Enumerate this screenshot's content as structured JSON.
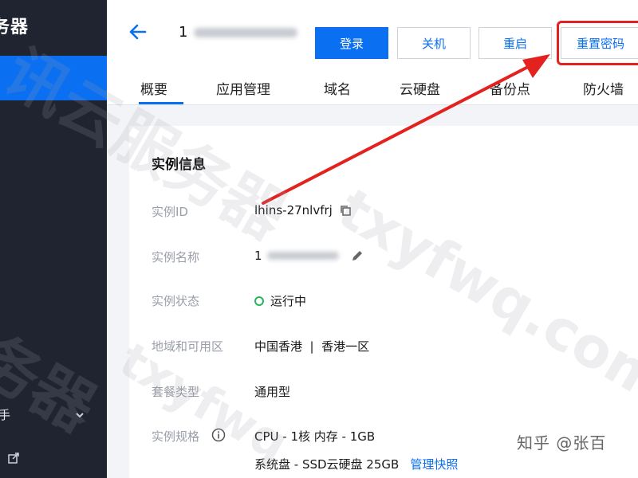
{
  "sidebar": {
    "title": "务器",
    "item_label": "手"
  },
  "header": {
    "title_prefix": "1"
  },
  "toolbar": {
    "login_label": "登录",
    "shutdown_label": "关机",
    "restart_label": "重启",
    "reset_password_label": "重置密码"
  },
  "tabs": [
    "概要",
    "应用管理",
    "域名",
    "云硬盘",
    "备份点",
    "防火墙"
  ],
  "instance_info": {
    "title": "实例信息",
    "rows": [
      {
        "label": "实例ID",
        "value": "lhins-27nlvfrj"
      },
      {
        "label": "实例名称",
        "value": "1"
      },
      {
        "label": "实例状态",
        "value": "运行中"
      },
      {
        "label": "地域和可用区",
        "value": "中国香港  |  香港一区"
      },
      {
        "label": "套餐类型",
        "value": "通用型"
      },
      {
        "label": "实例规格",
        "value": "CPU - 1核 内存 - 1GB"
      }
    ],
    "system_disk": "系统盘 - SSD云硬盘 25GB",
    "manage_snapshot": "管理快照"
  },
  "watermark": {
    "line1": "讯云服务器",
    "line2": "txyfwq.com",
    "line3": "务器",
    "line4": "txyfwq"
  },
  "footer_brand": "知乎 @张百",
  "colors": {
    "primary": "#0a6ff0",
    "highlight": "#e3211f",
    "sidebar_bg": "#1f2430",
    "status_running": "#26b45a"
  },
  "icons": [
    "back-arrow-icon",
    "copy-icon",
    "edit-icon",
    "info-icon",
    "chevron-down-icon",
    "external-link-icon",
    "status-running-icon"
  ]
}
